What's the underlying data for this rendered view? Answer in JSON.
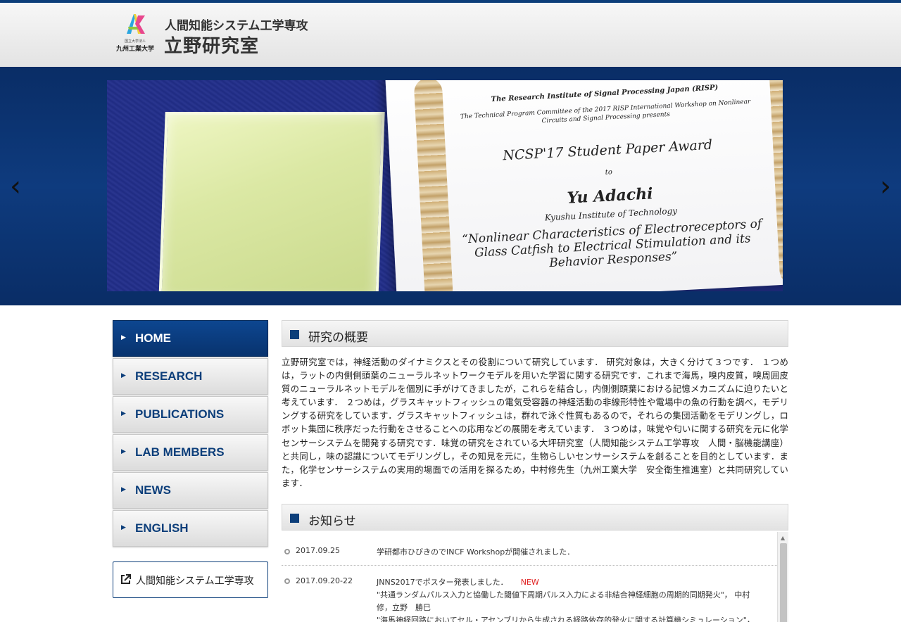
{
  "header": {
    "logo_university": "九州工業大学",
    "logo_small": "国立大学法人",
    "department": "人間知能システム工学専攻",
    "lab_name": "立野研究室"
  },
  "slider": {
    "certificate": {
      "institute": "The Research Institute of Signal Processing Japan (RISP)",
      "committee": "The Technical Program Committee of the 2017 RISP International Workshop on Nonlinear Circuits and Signal Processing presents",
      "award": "NCSP'17 Student Paper Award",
      "to": "to",
      "name": "Yu Adachi",
      "affiliation": "Kyushu Institute of Technology",
      "paper_title": "“Nonlinear Characteristics of Electroreceptors of Glass Catfish to Electrical Stimulation and its Behavior Responses”"
    },
    "prev_icon": "‹",
    "next_icon": "›"
  },
  "sidebar": {
    "items": [
      {
        "label": "HOME",
        "active": true
      },
      {
        "label": "RESEARCH"
      },
      {
        "label": "PUBLICATIONS"
      },
      {
        "label": "LAB MEMBERS"
      },
      {
        "label": "NEWS"
      },
      {
        "label": "ENGLISH"
      }
    ],
    "external_link": "人間知能システム工学専攻"
  },
  "overview": {
    "title": "研究の概要",
    "body": "立野研究室では，神経活動のダイナミクスとその役割について研究しています． 研究対象は，大きく分けて３つです． １つめは，ラットの内側側頭葉のニューラルネットワークモデルを用いた学習に関する研究です．これまで海馬，嗅内皮質，嗅周囲皮質のニューラルネットモデルを個別に手がけてきましたが，これらを結合し，内側側頭葉における記憶メカニズムに迫りたいと考えています． ２つめは，グラスキャットフィッシュの電気受容器の神経活動の非線形特性や電場中の魚の行動を調べ，モデリングする研究をしています．グラスキャットフィッシュは，群れで泳ぐ性質もあるので，それらの集団活動をモデリングし，ロボット集団に秩序だった行動をさせることへの応用などの展開を考えています． ３つめは，味覚や匂いに関する研究を元に化学センサーシステムを開発する研究です．味覚の研究をされている大坪研究室（人間知能システム工学専攻　人間・脳機能講座）と共同し，味の認識についてモデリングし，その知見を元に，生物らしいセンサーシステムを創ることを目的としています．また，化学センサーシステムの実用的場面での活用を探るため，中村修先生（九州工業大学　安全衛生推進室）と共同研究しています．"
  },
  "news": {
    "title": "お知らせ",
    "items": [
      {
        "date": "2017.09.25",
        "text": "学研都市ひびきのでINCF Workshopが開催されました．"
      },
      {
        "date": "2017.09.20-22",
        "text": "JNNS2017でポスター発表しました．",
        "badge": "NEW",
        "detail": "\"共通ランダムパルス入力と協働した閾値下周期パルス入力による非結合神経細胞の周期的同期発火\"， 中村　修，立野　勝巳",
        "detail2": "\"海馬神経回路においてセル・アセンブリから生成される経路依存的発火に関する計算機シミュレーション\"，"
      }
    ]
  },
  "colors": {
    "brand": "#0c3e7a",
    "new": "#e02020"
  }
}
